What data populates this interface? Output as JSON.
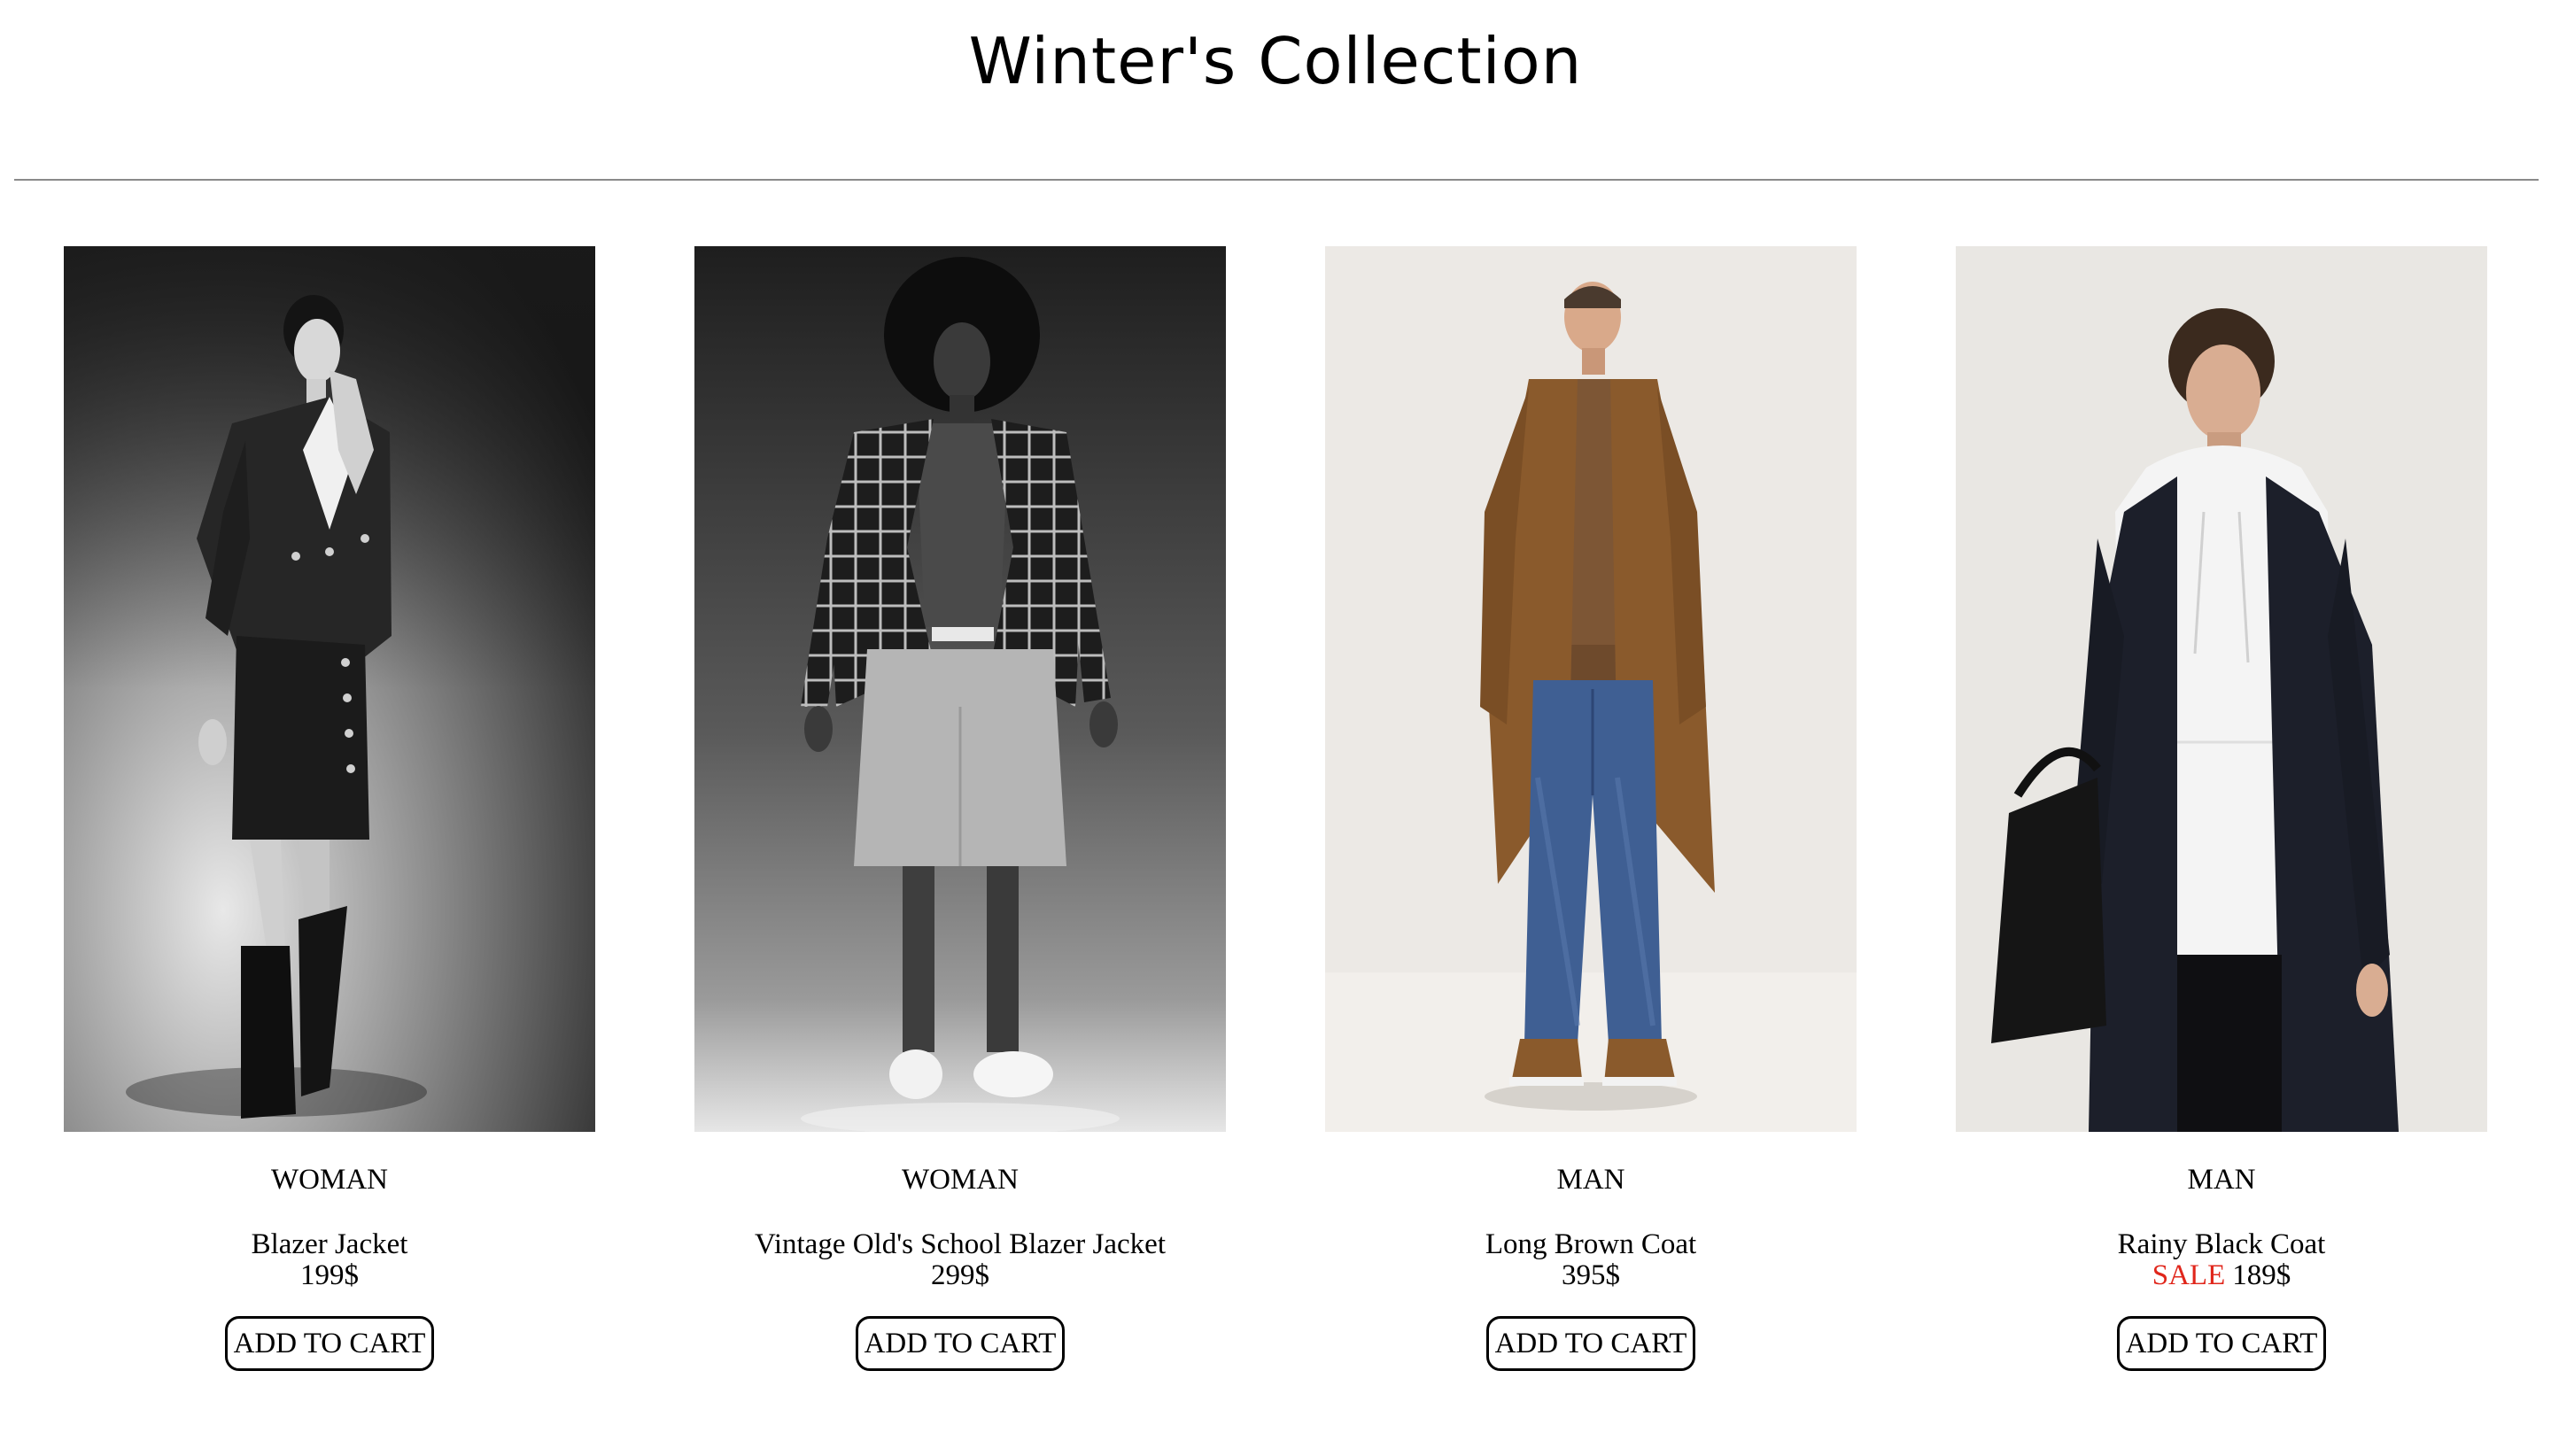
{
  "page": {
    "title": "Winter's Collection"
  },
  "products": [
    {
      "category": "WOMAN",
      "name": "Blazer Jacket",
      "sale_label": "",
      "price": "199$",
      "button_label": "ADD TO CART",
      "image_alt": "Woman in black tweed blazer and skirt with knee-high boots"
    },
    {
      "category": "WOMAN",
      "name": "Vintage Old's School Blazer Jacket",
      "sale_label": "",
      "price": "299$",
      "button_label": "ADD TO CART",
      "image_alt": "Woman in checked blazer with grey shorts and white sneakers"
    },
    {
      "category": "MAN",
      "name": "Long Brown Coat",
      "sale_label": "",
      "price": "395$",
      "button_label": "ADD TO CART",
      "image_alt": "Man in long brown coat with blue jeans"
    },
    {
      "category": "MAN",
      "name": "Rainy Black Coat",
      "sale_label": "SALE",
      "price": "189$",
      "button_label": "ADD TO CART",
      "image_alt": "Man in black coat over white hoodie holding black bag"
    }
  ],
  "colors": {
    "sale": "#e0261b",
    "divider": "#8a8a8a",
    "text": "#000000",
    "background": "#ffffff"
  }
}
